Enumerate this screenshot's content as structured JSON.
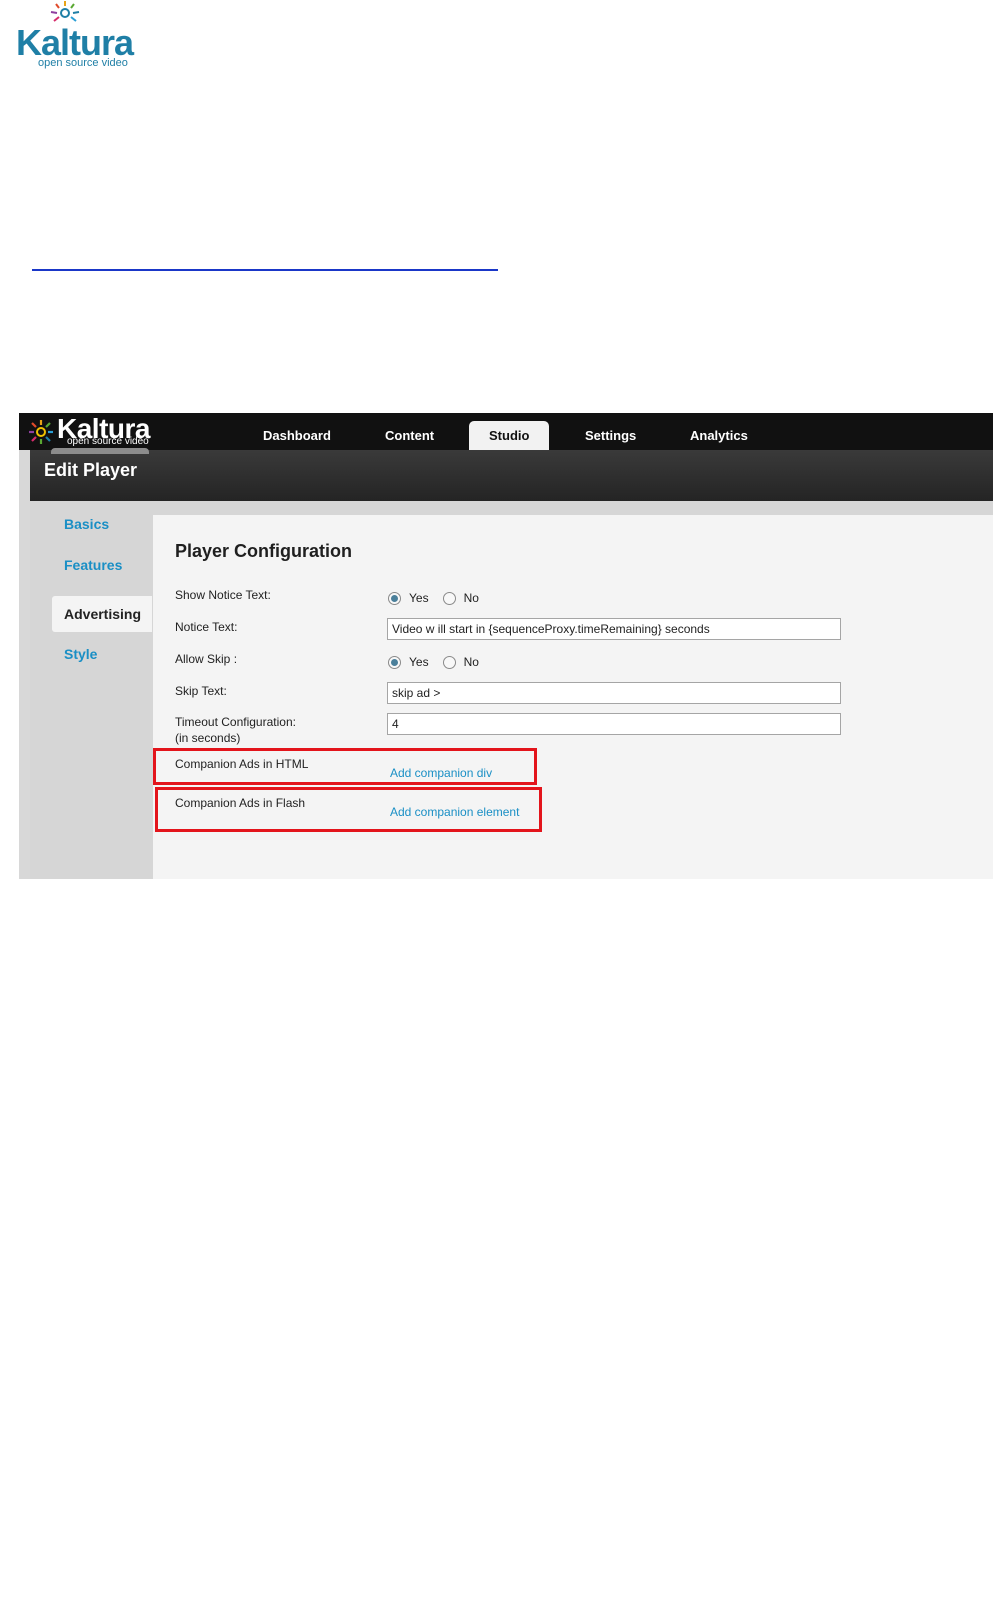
{
  "page": {
    "logo": {
      "word": "Kaltura",
      "tagline": "open source video"
    }
  },
  "app": {
    "logo": {
      "word": "Kaltura",
      "tagline": "open source video"
    },
    "nav": [
      "Dashboard",
      "Content",
      "Studio",
      "Settings",
      "Analytics"
    ],
    "active_nav": "Studio",
    "page_title": "Edit Player",
    "sidebar": [
      "Basics",
      "Features",
      "Advertising",
      "Style"
    ],
    "active_sidebar": "Advertising"
  },
  "config": {
    "title": "Player Configuration",
    "show_notice_label": "Show Notice Text:",
    "yes": "Yes",
    "no": "No",
    "notice_text_label": "Notice Text:",
    "notice_text_value": "Video w ill start in {sequenceProxy.timeRemaining} seconds",
    "allow_skip_label": "Allow Skip :",
    "skip_text_label": "Skip Text:",
    "skip_text_value": "skip ad >",
    "timeout_label_1": "Timeout Configuration:",
    "timeout_label_2": "(in seconds)",
    "timeout_value": "4",
    "companion_html_label": "Companion Ads in HTML",
    "companion_html_link": "Add companion div",
    "companion_flash_label": "Companion Ads in Flash",
    "companion_flash_link": "Add companion element"
  },
  "colors": {
    "link": "#1a8fc5",
    "highlight": "#e3141b",
    "brand": "#1f7fa6"
  }
}
